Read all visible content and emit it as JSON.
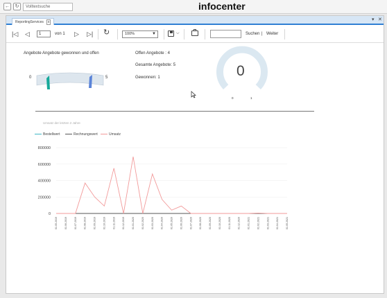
{
  "topbar": {
    "search_placeholder": "Volltextsuche",
    "app_title": "infocenter"
  },
  "tab": {
    "label": "ReportingServices",
    "close": "x"
  },
  "window_controls": {
    "dropdown": "▾",
    "close": "✕"
  },
  "toolbar": {
    "first": "|◁",
    "prev": "◁",
    "page": "1",
    "of_label": "von 1",
    "next": "▷",
    "last": "▷|",
    "refresh": "↻",
    "zoom": "100%",
    "find_label": "Suchen",
    "find_sep": "|",
    "next_label": "Weiter"
  },
  "gauge_left": {
    "title": "Angebote Angebote gewonnen und offen",
    "min": "0",
    "max": "5",
    "value_open": 4,
    "value_won": 1
  },
  "stats": {
    "open": "Offen Angebote : 4",
    "total": "Gesamte Angebote: 5",
    "won": "Gewonnen: 1"
  },
  "gauge_right": {
    "value": "0",
    "min": "0",
    "max": "1"
  },
  "chart_data": {
    "type": "line",
    "title": "Umsatz der letzten 2 Jahre",
    "ylim": [
      0,
      800000
    ],
    "y_ticks": [
      "800000",
      "600000",
      "400000",
      "200000",
      "0"
    ],
    "categories": [
      "01.05.2019",
      "01.06.2019",
      "01.07.2019",
      "01.08.2019",
      "01.09.2019",
      "01.10.2019",
      "01.11.2019",
      "01.12.2019",
      "01.01.2020",
      "01.02.2020",
      "01.03.2020",
      "01.04.2020",
      "01.05.2020",
      "01.06.2020",
      "01.07.2020",
      "01.08.2020",
      "01.09.2020",
      "01.10.2020",
      "01.11.2020",
      "01.12.2020",
      "01.01.2021",
      "01.02.2021",
      "01.03.2021",
      "01.04.2021",
      "01.05.2021"
    ],
    "series": [
      {
        "name": "Bestellwert",
        "color": "#3fb6c6",
        "values": [
          0,
          0,
          0,
          0,
          0,
          0,
          0,
          0,
          0,
          0,
          0,
          0,
          0,
          0,
          0,
          0,
          0,
          0,
          0,
          0,
          0,
          0,
          0,
          0,
          0
        ]
      },
      {
        "name": "Rechnungswert",
        "color": "#555555",
        "values": [
          0,
          0,
          0,
          0,
          0,
          0,
          0,
          0,
          0,
          0,
          0,
          0,
          0,
          0,
          0,
          0,
          0,
          0,
          0,
          0,
          0,
          0,
          0,
          0,
          0
        ]
      },
      {
        "name": "Umsatz",
        "color": "#f29a9a",
        "values": [
          0,
          0,
          0,
          370000,
          200000,
          90000,
          550000,
          0,
          690000,
          0,
          480000,
          170000,
          40000,
          90000,
          0,
          0,
          0,
          0,
          0,
          0,
          0,
          5000,
          0,
          0,
          0
        ]
      }
    ]
  }
}
